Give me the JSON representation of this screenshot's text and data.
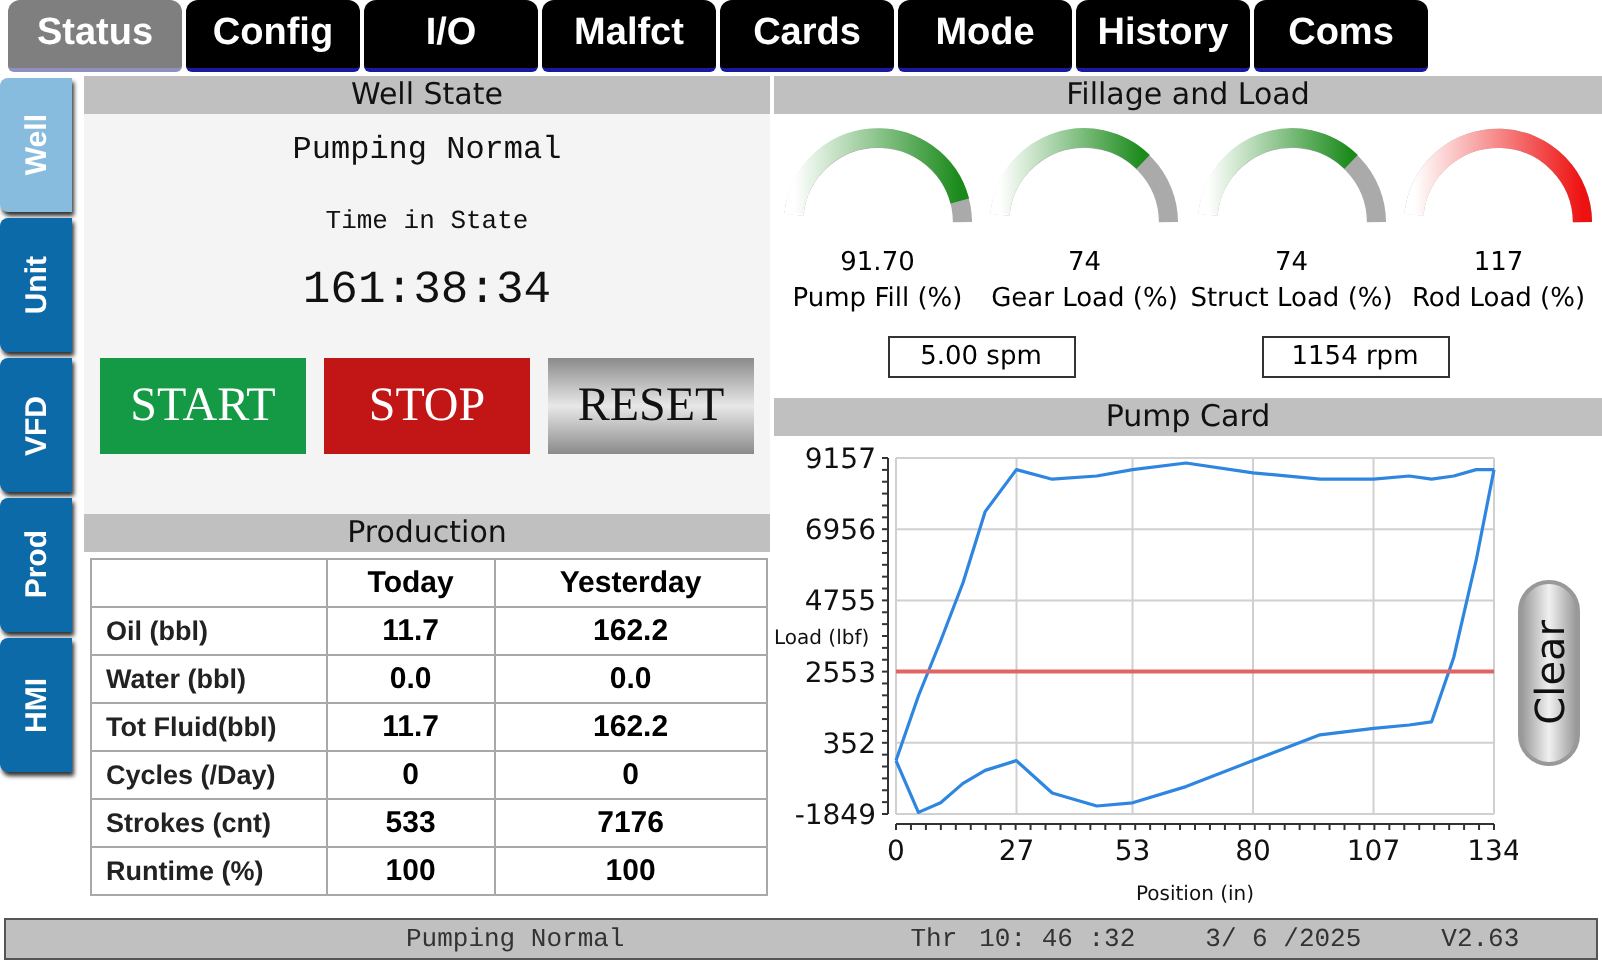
{
  "tabs": [
    {
      "label": "Status",
      "selected": true
    },
    {
      "label": "Config",
      "selected": false
    },
    {
      "label": "I/O",
      "selected": false
    },
    {
      "label": "Malfct",
      "selected": false
    },
    {
      "label": "Cards",
      "selected": false
    },
    {
      "label": "Mode",
      "selected": false
    },
    {
      "label": "History",
      "selected": false
    },
    {
      "label": "Coms",
      "selected": false
    }
  ],
  "side_tabs": [
    {
      "label": "Well",
      "selected": true
    },
    {
      "label": "Unit",
      "selected": false
    },
    {
      "label": "VFD",
      "selected": false
    },
    {
      "label": "Prod",
      "selected": false
    },
    {
      "label": "HMI",
      "selected": false
    }
  ],
  "well_state": {
    "title": "Well State",
    "state": "Pumping Normal",
    "time_label": "Time in State",
    "time": "161:38:34",
    "buttons": [
      {
        "label": "START",
        "kind": "start"
      },
      {
        "label": "STOP",
        "kind": "stop"
      },
      {
        "label": "RESET",
        "kind": "reset"
      }
    ]
  },
  "production": {
    "title": "Production",
    "columns": [
      "Today",
      "Yesterday"
    ],
    "rows": [
      {
        "label": "Oil (bbl)",
        "values": [
          "11.7",
          "162.2"
        ]
      },
      {
        "label": "Water (bbl)",
        "values": [
          "0.0",
          "0.0"
        ]
      },
      {
        "label": "Tot Fluid(bbl)",
        "values": [
          "11.7",
          "162.2"
        ]
      },
      {
        "label": "Cycles (/Day)",
        "values": [
          "0",
          "0"
        ]
      },
      {
        "label": "Strokes (cnt)",
        "values": [
          "533",
          "7176"
        ]
      },
      {
        "label": "Runtime (%)",
        "values": [
          "100",
          "100"
        ]
      }
    ]
  },
  "fillage": {
    "title": "Fillage and Load",
    "gauges": [
      {
        "value": "91.70",
        "label": "Pump Fill (%)",
        "level": 0.917,
        "kind": "normal"
      },
      {
        "value": "74",
        "label": "Gear Load (%)",
        "level": 0.74,
        "kind": "normal"
      },
      {
        "value": "74",
        "label": "Struct Load (%)",
        "level": 0.74,
        "kind": "normal"
      },
      {
        "value": "117",
        "label": "Rod Load (%)",
        "level": 1,
        "kind": "alarm"
      }
    ],
    "readouts": [
      "5.00 spm",
      "1154 rpm"
    ]
  },
  "pump_card": {
    "title": "Pump Card",
    "clear_button": "Clear",
    "chart_data": {
      "type": "line",
      "xlabel": "Position (in)",
      "ylabel": "Load (lbf)",
      "x": [
        0,
        5,
        10,
        15,
        20,
        27,
        35,
        45,
        53,
        65,
        80,
        95,
        107,
        115,
        120,
        125,
        130,
        134
      ],
      "series": [
        {
          "color": "#2f86e0",
          "values": [
            -200,
            1800,
            3500,
            5300,
            7500,
            8800,
            8500,
            8600,
            8800,
            9000,
            8700,
            8500,
            8500,
            8600,
            8500,
            8600,
            8800,
            8800
          ]
        },
        {
          "color": "#2f86e0",
          "values": [
            -200,
            -1800,
            -1500,
            -900,
            -500,
            -200,
            -1200,
            -1600,
            -1500,
            -1000,
            -200,
            600,
            800,
            900,
            1000,
            3000,
            6000,
            8800
          ]
        },
        {
          "color": "#e06666",
          "values": [
            2553,
            2553,
            2553,
            2553,
            2553,
            2553,
            2553,
            2553,
            2553,
            2553,
            2553,
            2553,
            2553,
            2553,
            2553,
            2553,
            2553,
            2553
          ]
        }
      ],
      "grid": true,
      "xlim": [
        0,
        134
      ],
      "ylim": [
        -1849,
        9157
      ],
      "xticks": [
        0,
        27,
        53,
        80,
        107,
        134
      ],
      "yticks": [
        9157,
        6956,
        4755,
        2553,
        352,
        -1849
      ]
    }
  },
  "status_bar": {
    "state": "Pumping Normal",
    "day": "Thr",
    "time": "10: 46 :32",
    "date": "3/ 6 /2025",
    "version": "V2.63"
  }
}
